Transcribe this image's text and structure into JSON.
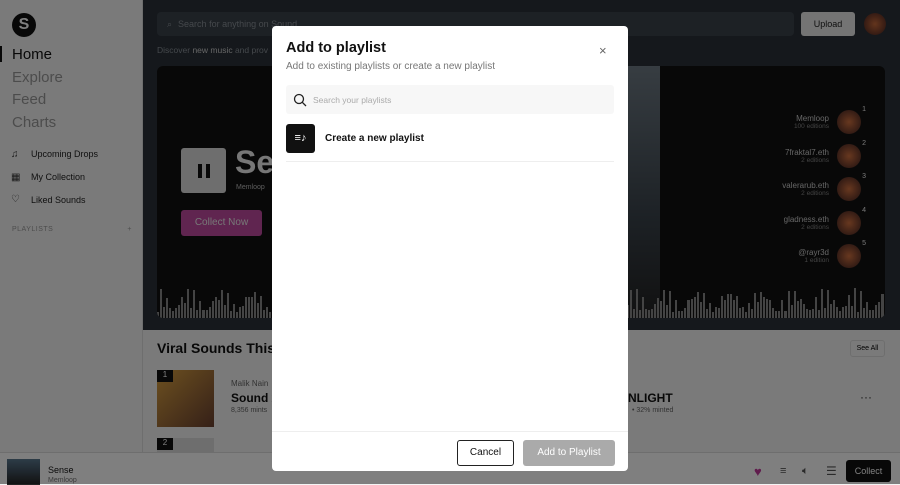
{
  "sidebar": {
    "logo": "S",
    "nav": [
      "Home",
      "Explore",
      "Feed",
      "Charts"
    ],
    "links": [
      {
        "icon": "♫",
        "label": "Upcoming Drops"
      },
      {
        "icon": "▦",
        "label": "My Collection"
      },
      {
        "icon": "♡",
        "label": "Liked Sounds"
      }
    ],
    "playlists_label": "PLAYLISTS",
    "add": "+"
  },
  "header": {
    "search_placeholder": "Search for anything on Sound",
    "upload": "Upload",
    "discover_a": "Discover ",
    "discover_b": "new music",
    "discover_c": " and prov"
  },
  "hero": {
    "title": "Se",
    "artist": "Memloop",
    "collect": "Collect Now",
    "collectors": [
      {
        "name": "Memloop",
        "editions": "100 editions",
        "rank": "1"
      },
      {
        "name": "7fraktal7.eth",
        "editions": "2 editions",
        "rank": "2"
      },
      {
        "name": "valerarub.eth",
        "editions": "2 editions",
        "rank": "3"
      },
      {
        "name": "gladness.eth",
        "editions": "2 editions",
        "rank": "4"
      },
      {
        "name": "@rayr3d",
        "editions": "1 edition",
        "rank": "5"
      }
    ]
  },
  "viral": {
    "title": "Viral Sounds This W",
    "see_all": "See All",
    "rows": [
      {
        "rank": "1",
        "artist": "Malik Nain",
        "title": "Sound x",
        "mints": "8,356 mints",
        "title2": "NLIGHT",
        "minted": "• 32% minted"
      },
      {
        "rank": "2"
      }
    ]
  },
  "player": {
    "title": "Sense",
    "artist": "Memloop",
    "collect": "Collect"
  },
  "modal": {
    "title": "Add to playlist",
    "subtitle": "Add to existing playlists or create a new playlist",
    "search_placeholder": "Search your playlists",
    "create": "Create a new playlist",
    "cancel": "Cancel",
    "add": "Add to Playlist",
    "close": "×"
  }
}
